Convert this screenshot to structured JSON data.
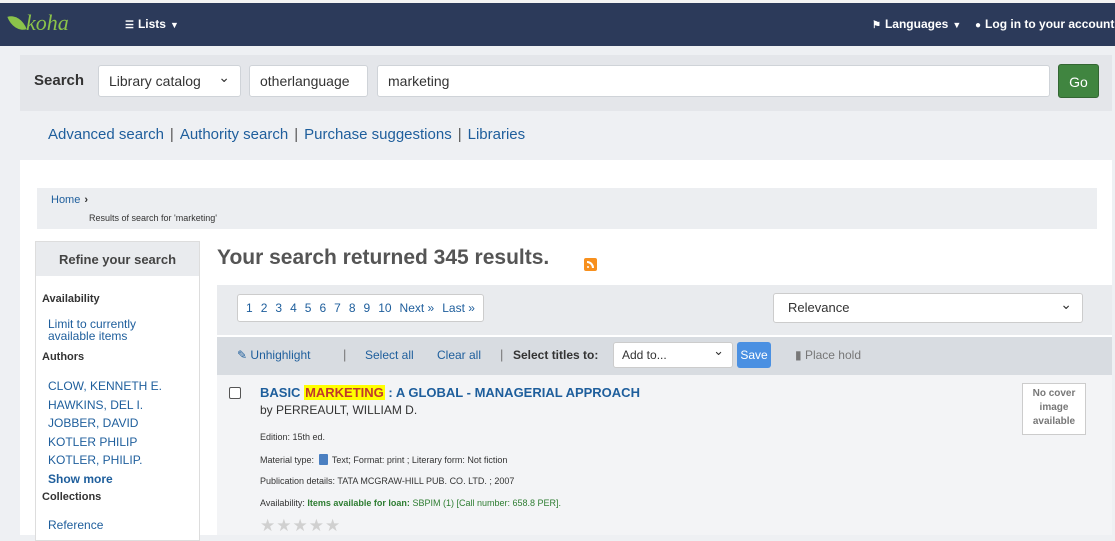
{
  "navbar": {
    "logo_text": "koha",
    "lists_label": "Lists",
    "languages_label": "Languages",
    "login_label": "Log in to your account"
  },
  "search": {
    "label": "Search",
    "scope_value": "Library catalog",
    "filter_value": "otherlanguage",
    "query_value": "marketing",
    "go_label": "Go"
  },
  "quicklinks": [
    "Advanced search",
    "Authority search",
    "Purchase suggestions",
    "Libraries"
  ],
  "breadcrumb": {
    "home": "Home",
    "current": "Results of search for 'marketing'"
  },
  "refine": {
    "title": "Refine your search",
    "availability_heading": "Availability",
    "availability_link_1": "Limit to currently",
    "availability_link_2": "available items",
    "authors_heading": "Authors",
    "authors": [
      "CLOW, KENNETH E.",
      "HAWKINS, DEL I.",
      "JOBBER, DAVID",
      "KOTLER PHILIP",
      "KOTLER, PHILIP."
    ],
    "show_more": "Show more",
    "collections_heading": "Collections",
    "collections": [
      "Reference"
    ]
  },
  "results": {
    "summary": "Your search returned 345 results."
  },
  "pagination": {
    "pages": [
      "1",
      "2",
      "3",
      "4",
      "5",
      "6",
      "7",
      "8",
      "9",
      "10"
    ],
    "next": "Next »",
    "last": "Last »"
  },
  "sort": {
    "value": "Relevance"
  },
  "toolbar": {
    "unhighlight": "Unhighlight",
    "select_all": "Select all",
    "clear_all": "Clear all",
    "select_titles_to": "Select titles to:",
    "add_to": "Add to...",
    "save": "Save",
    "place_hold": "Place hold"
  },
  "record": {
    "title_before": "BASIC ",
    "title_highlight": "MARKETING",
    "title_after": " : A GLOBAL - MANAGERIAL APPROACH",
    "author": "by PERREAULT, WILLIAM D.",
    "edition": "Edition: 15th ed.",
    "material_label": "Material type:",
    "material_rest": "Text; Format: print ; Literary form: Not fiction",
    "publication": "Publication details: TATA MCGRAW-HILL PUB. CO. LTD. ; 2007",
    "availability_label": "Availability:",
    "availability_strong": "Items available for loan:",
    "availability_rest": "SBPIM (1) [Call number: 658.8 PER].",
    "stars": "★★★★★",
    "no_cover_1": "No cover",
    "no_cover_2": "image",
    "no_cover_3": "available"
  },
  "colors": {
    "navbar": "#2c3a5a",
    "go_button": "#408540",
    "link": "#1e5e9c",
    "highlight": "#ffff00",
    "available": "#2e7d32"
  }
}
